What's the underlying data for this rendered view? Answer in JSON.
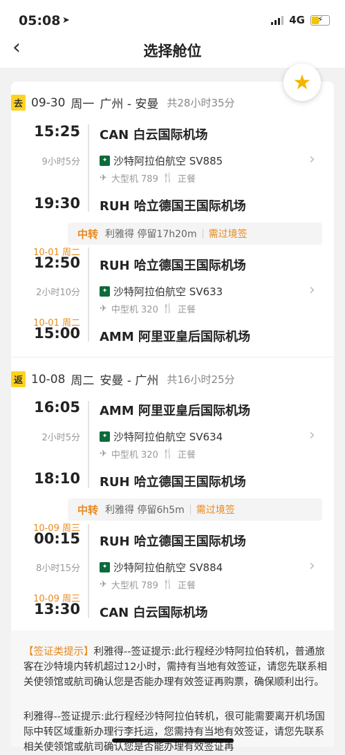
{
  "status": {
    "time": "05:08",
    "network": "4G"
  },
  "nav": {
    "title": "选择舱位"
  },
  "outbound": {
    "tag": "去",
    "date": "09-30",
    "weekday": "周一",
    "route": "广州 - 安曼",
    "total": "共28小时35分",
    "legs": [
      {
        "dep_time": "15:25",
        "dep_airport": "CAN 白云国际机场",
        "duration": "9小时5分",
        "airline": "沙特阿拉伯航空 SV885",
        "aircraft": "大型机 789",
        "meal": "正餐",
        "arr_time": "19:30",
        "arr_airport": "RUH 哈立德国王国际机场"
      },
      {
        "dep_date": "10-01 周二",
        "dep_time": "12:50",
        "dep_airport": "RUH 哈立德国王国际机场",
        "duration": "2小时10分",
        "airline": "沙特阿拉伯航空 SV633",
        "aircraft": "中型机 320",
        "meal": "正餐",
        "arr_date": "10-01 周二",
        "arr_time": "15:00",
        "arr_airport": "AMM 阿里亚皇后国际机场"
      }
    ],
    "transfer": {
      "label": "中转",
      "stop": "利雅得 停留17h20m",
      "visa": "需过境签"
    }
  },
  "return": {
    "tag": "返",
    "date": "10-08",
    "weekday": "周二",
    "route": "安曼 - 广州",
    "total": "共16小时25分",
    "legs": [
      {
        "dep_time": "16:05",
        "dep_airport": "AMM 阿里亚皇后国际机场",
        "duration": "2小时5分",
        "airline": "沙特阿拉伯航空 SV634",
        "aircraft": "中型机 320",
        "meal": "正餐",
        "arr_time": "18:10",
        "arr_airport": "RUH 哈立德国王国际机场"
      },
      {
        "dep_date": "10-09 周三",
        "dep_time": "00:15",
        "dep_airport": "RUH 哈立德国王国际机场",
        "duration": "8小时15分",
        "airline": "沙特阿拉伯航空 SV884",
        "aircraft": "大型机 789",
        "meal": "正餐",
        "arr_date": "10-09 周三",
        "arr_time": "13:30",
        "arr_airport": "CAN 白云国际机场"
      }
    ],
    "transfer": {
      "label": "中转",
      "stop": "利雅得 停留6h5m",
      "visa": "需过境签"
    }
  },
  "tips": {
    "label": "【签证类提示】",
    "p1": "利雅得--签证提示:此行程经沙特阿拉伯转机，普通旅客在沙特境内转机超过12小时，需持有当地有效签证，请您先联系相关使领馆或航司确认您是否能办理有效签证再购票，确保顺利出行。",
    "p2": "利雅得--签证提示:此行程经沙特阿拉伯转机，很可能需要离开机场国际中转区域重新办理行李托运，您需持有当地有效签证，请您先联系相关使领馆或航司确认您是否能办理有效签证再"
  },
  "colors": {
    "accent": "#e8891e",
    "tag": "#ffd21f",
    "star": "#f5b400"
  }
}
